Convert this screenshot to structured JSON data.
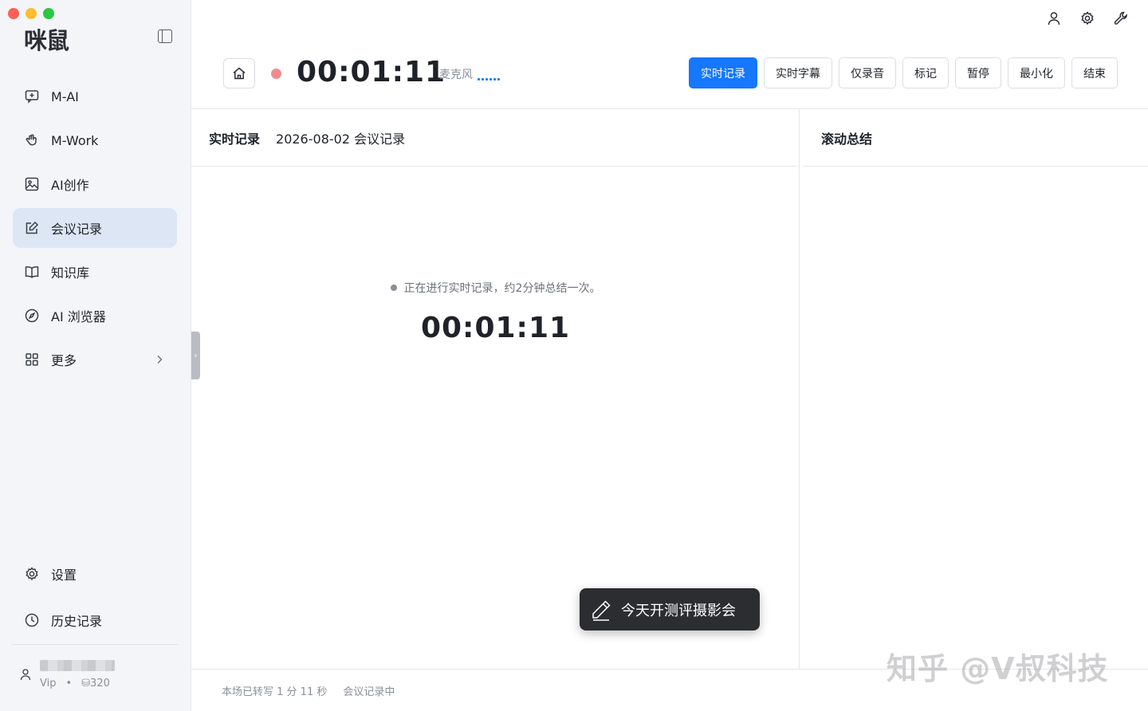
{
  "app": {
    "logo_text": "咪鼠"
  },
  "sidebar": {
    "items": [
      {
        "label": "M-AI",
        "icon": "chat-plus-icon"
      },
      {
        "label": "M-Work",
        "icon": "hand-icon"
      },
      {
        "label": "AI创作",
        "icon": "image-icon"
      },
      {
        "label": "会议记录",
        "icon": "edit-note-icon",
        "active": true
      },
      {
        "label": "知识库",
        "icon": "book-icon"
      },
      {
        "label": "AI 浏览器",
        "icon": "compass-icon"
      },
      {
        "label": "更多",
        "icon": "grid-icon"
      }
    ],
    "bottom": [
      {
        "label": "设置",
        "icon": "gear-icon"
      },
      {
        "label": "历史记录",
        "icon": "clock-icon"
      }
    ],
    "user": {
      "level": "Vip",
      "points": "⛁320"
    }
  },
  "header": {
    "timer": "00:01:11",
    "mic_label": "麦克风",
    "actions": [
      "实时记录",
      "实时字幕",
      "仅录音",
      "标记",
      "暂停",
      "最小化",
      "结束"
    ]
  },
  "left_pane": {
    "title": "实时记录",
    "subtitle": "2026-08-02 会议记录",
    "status": "正在进行实时记录，约2分钟总结一次。",
    "timer": "00:01:11"
  },
  "right_pane": {
    "title": "滚动总结"
  },
  "toast": {
    "text": "今天开测评摄影会"
  },
  "footer": {
    "transcribed": "本场已转写 1 分 11 秒",
    "state": "会议记录中"
  },
  "watermark": "知乎 @V叔科技",
  "colors": {
    "primary": "#1677ff",
    "active_nav": "#dde6f5",
    "record_dot": "#f08a8f"
  }
}
